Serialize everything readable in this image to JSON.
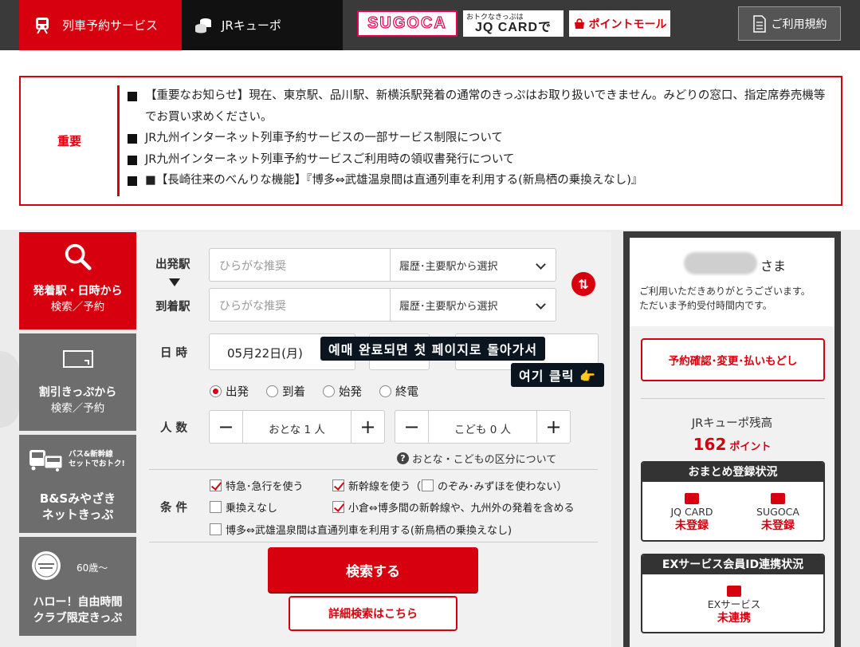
{
  "nav": {
    "tab_reserve": "列車予約サービス",
    "tab_cubo": "JRキューポ",
    "banner_sugoca": "SUGOCA",
    "banner_jq_small": "おトクなきっぷは",
    "banner_jq_big": "JQ CARDで",
    "banner_point": "ポイントモール",
    "terms": "ご利用規約"
  },
  "notice": {
    "label": "重要",
    "items": [
      "【重要なお知らせ】現在、東京駅、品川駅、新横浜駅発着の通常のきっぷはお取り扱いできません。みどりの窓口、指定席券売機等でお買い求めください。",
      "JR九州インターネット列車予約サービスの一部サービス制限について",
      "JR九州インターネット列車予約サービスご利用時の領収書発行について",
      "■【長崎往来のべんりな機能】『博多⇔武雄温泉間は直通列車を利用する(新鳥栖の乗換えなし)』"
    ]
  },
  "leftmenu": {
    "search_l1": "発着駅・日時から",
    "search_l2": "検索／予約",
    "discount_l1": "割引きっぷから",
    "discount_l2": "検索／予約",
    "bs_badge_l1": "バス&新幹線",
    "bs_badge_l2": "セットでおトク!",
    "bs_l1": "B&Sみやざき",
    "bs_l2": "ネットきっぷ",
    "hello_age": "60歳～",
    "hello_l1": "ハロー！自由時間",
    "hello_l2": "クラブ限定きっぷ"
  },
  "form": {
    "dep_label": "出発駅",
    "arr_label": "到着駅",
    "dep_placeholder": "ひらがな推奨",
    "arr_placeholder": "ひらがな推奨",
    "dep_select": "履歴･主要駅から選択",
    "arr_select": "履歴･主要駅から選択",
    "swap_icon": "⇅",
    "datetime_label": "日 時",
    "date_value": "05月22日(月)",
    "radios": [
      "出発",
      "到着",
      "始発",
      "終電"
    ],
    "radio_selected": 0,
    "people_label": "人 数",
    "adult_value": "おとな 1 人",
    "child_value": "こども 0 人",
    "help_text": "おとな・こどもの区分について",
    "cond_label": "条 件",
    "cb_express": "特急･急行を使う",
    "cb_shinkansen": "新幹線を使う（",
    "cb_nozomi": "のぞみ･みずほを使わない）",
    "cb_no_transfer": "乗換えなし",
    "cb_kokura": "小倉⇔博多間の新幹線や、九州外の発着を含める",
    "cb_direct": "博多⇔武雄温泉間は直通列車を利用する(新鳥栖の乗換えなし)",
    "search_button": "検索する",
    "detail_button": "詳細検索はこちら"
  },
  "overlay": {
    "line1": "예매 완료되면 첫 페이지로 돌아가서",
    "line2": "여기 클릭 👉"
  },
  "right": {
    "sama": "さま",
    "greet_l1": "ご利用いただきありがとうございます。",
    "greet_l2": "ただいま予約受付時間内です。",
    "confirm_button": "予約確認･変更･払いもどし",
    "cubo_title": "JRキューポ残高",
    "cubo_points": "162",
    "cubo_unit": "ポイント",
    "matome_title": "おまとめ登録状況",
    "jq_name": "JQ CARD",
    "jq_status": "未登録",
    "sugoca_name": "SUGOCA",
    "sugoca_status": "未登録",
    "ex_title": "EXサービス会員ID連携状況",
    "ex_name": "EXサービス",
    "ex_status": "未連携"
  },
  "colors": {
    "accent": "#d7000f",
    "dark": "#3a3a3a",
    "menu_gray": "#6d6d6d"
  }
}
